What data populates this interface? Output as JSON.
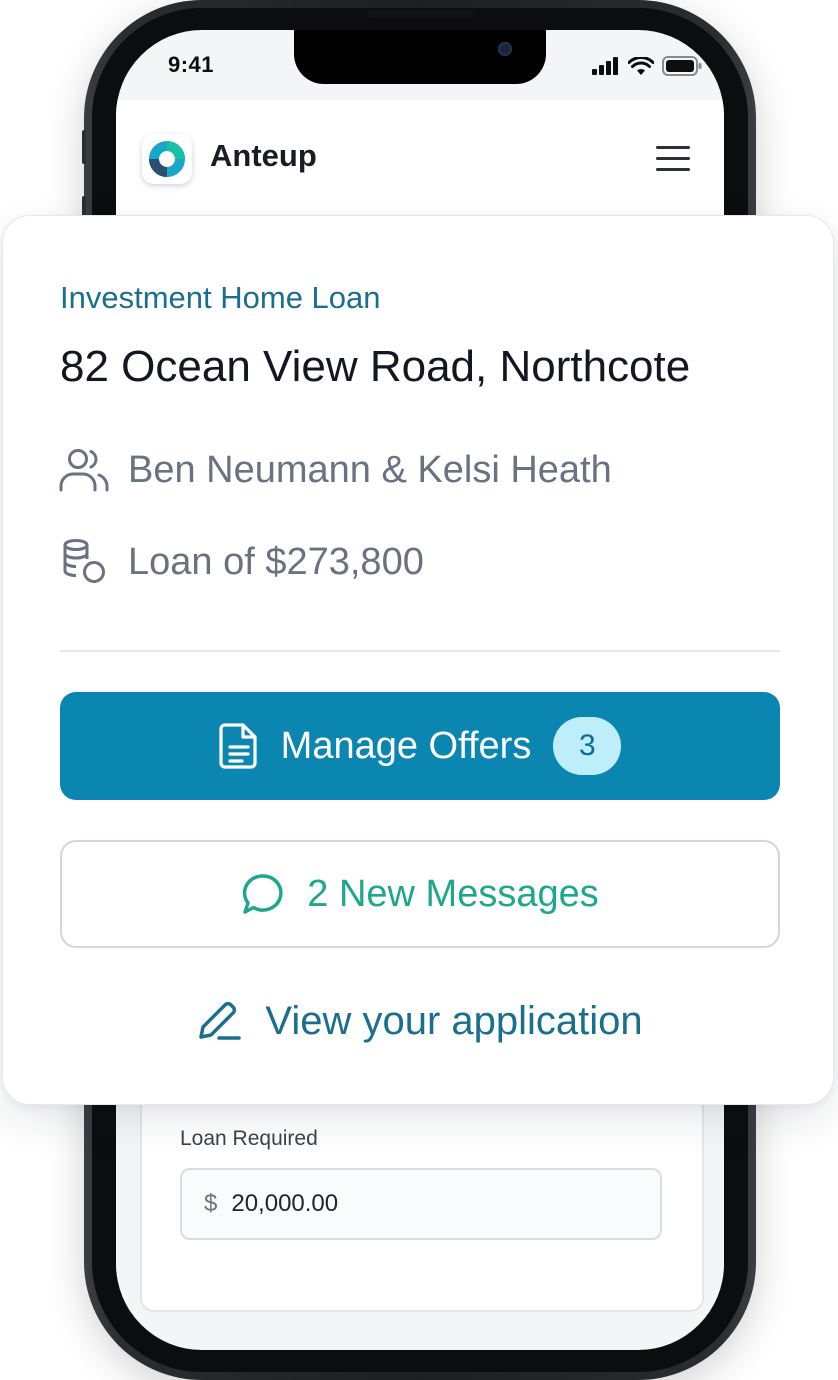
{
  "status_bar": {
    "time": "9:41"
  },
  "app": {
    "brand": "Anteup"
  },
  "loan_card": {
    "loan_type": "Investment Home Loan",
    "address": "82 Ocean View Road, Northcote",
    "borrowers": "Ben Neumann & Kelsi Heath",
    "loan_amount": "Loan of $273,800",
    "manage_offers_label": "Manage Offers",
    "offers_count": "3",
    "messages_label": "2 New Messages",
    "view_application_label": "View your application"
  },
  "loan_form": {
    "label": "Loan Required",
    "currency": "$",
    "value": "20,000.00"
  },
  "colors": {
    "primary": "#0b86b1",
    "accent_teal": "#1ea78c",
    "heading_blue": "#1b6e8e"
  },
  "icons": [
    "signal-icon",
    "wifi-icon",
    "battery-icon",
    "anteup-logo-icon",
    "hamburger-menu-icon",
    "users-icon",
    "coins-icon",
    "document-icon",
    "chat-bubble-icon",
    "pencil-icon"
  ]
}
